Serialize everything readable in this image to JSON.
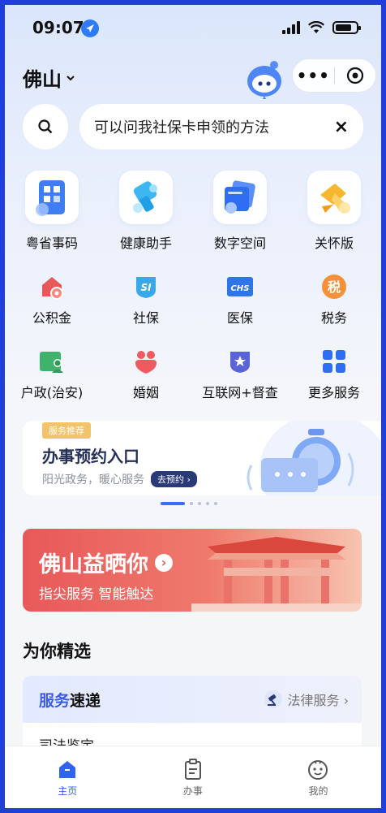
{
  "status": {
    "time": "09:07"
  },
  "header": {
    "city": "佛山",
    "more_label": "•••"
  },
  "search": {
    "placeholder": "可以问我社保卡申领的方法",
    "clear": "×"
  },
  "top_services": [
    {
      "label": "粤省事码",
      "icon": "qr-code-icon"
    },
    {
      "label": "健康助手",
      "icon": "health-assistant-icon"
    },
    {
      "label": "数字空间",
      "icon": "digital-space-icon"
    },
    {
      "label": "关怀版",
      "icon": "care-ribbon-icon"
    }
  ],
  "services_row1": [
    {
      "label": "公积金",
      "icon": "housing-fund-icon"
    },
    {
      "label": "社保",
      "icon": "social-security-icon",
      "icon_text": "SI"
    },
    {
      "label": "医保",
      "icon": "medical-insurance-icon",
      "icon_text": "CHS"
    },
    {
      "label": "税务",
      "icon": "tax-icon",
      "icon_text": "税"
    }
  ],
  "services_row2": [
    {
      "label": "户政(治安)",
      "icon": "household-icon"
    },
    {
      "label": "婚姻",
      "icon": "marriage-icon"
    },
    {
      "label": "互联网+督查",
      "icon": "supervision-icon"
    },
    {
      "label": "更多服务",
      "icon": "more-services-icon"
    }
  ],
  "banner_appointment": {
    "tag": "服务推荐",
    "title": "办事预约入口",
    "subtitle": "阳光政务，暖心服务",
    "pill": "去预约 ›"
  },
  "banner_foshan": {
    "title": "佛山益晒你",
    "subtitle": "指尖服务 智能触达"
  },
  "featured": {
    "title": "为你精选",
    "card_title_blue": "服务",
    "card_title_dark": "速递",
    "card_right": "法律服务 ›",
    "first_item": "司法鉴定"
  },
  "tabbar": [
    {
      "label": "主页",
      "active": true
    },
    {
      "label": "办事",
      "active": false
    },
    {
      "label": "我的",
      "active": false
    }
  ],
  "colors": {
    "accent": "#2f63f0",
    "banner_red": "#e8585a",
    "tag_gold": "#f2c36a"
  }
}
